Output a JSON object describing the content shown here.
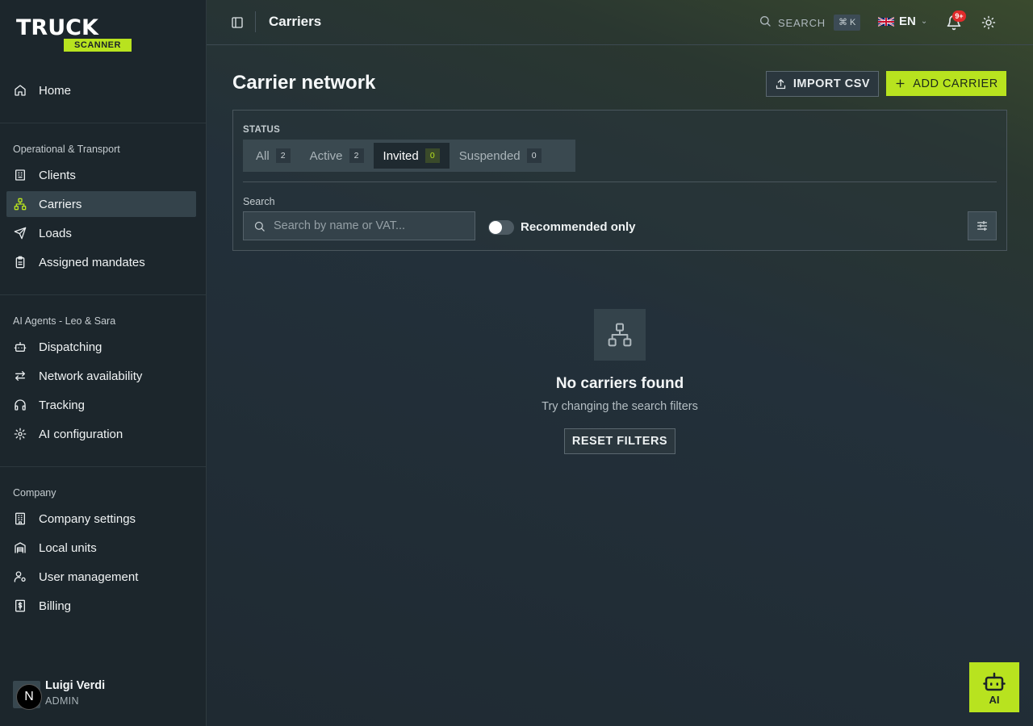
{
  "brand": {
    "name_top": "TRUCK",
    "name_bottom": "SCANNER",
    "accent_color": "#b8e31f"
  },
  "sidebar": {
    "home": {
      "label": "Home",
      "icon": "home-icon"
    },
    "sections": [
      {
        "title": "Operational & Transport"
      },
      {
        "title": "AI Agents - Leo & Sara"
      },
      {
        "title": "Company"
      }
    ],
    "items": {
      "clients": {
        "label": "Clients",
        "icon": "building-icon"
      },
      "carriers": {
        "label": "Carriers",
        "icon": "network-icon",
        "active": true
      },
      "loads": {
        "label": "Loads",
        "icon": "send-icon"
      },
      "mandates": {
        "label": "Assigned mandates",
        "icon": "clipboard-icon"
      },
      "dispatching": {
        "label": "Dispatching",
        "icon": "bot-icon"
      },
      "network": {
        "label": "Network availability",
        "icon": "arrows-icon"
      },
      "tracking": {
        "label": "Tracking",
        "icon": "headphones-icon"
      },
      "ai_config": {
        "label": "AI configuration",
        "icon": "gear-icon"
      },
      "company_settings": {
        "label": "Company settings",
        "icon": "office-icon"
      },
      "local_units": {
        "label": "Local units",
        "icon": "warehouse-icon"
      },
      "user_management": {
        "label": "User management",
        "icon": "user-cog-icon"
      },
      "billing": {
        "label": "Billing",
        "icon": "dollar-icon"
      }
    },
    "user": {
      "initial": "N",
      "name": "Luigi Verdi",
      "role": "ADMIN"
    }
  },
  "topbar": {
    "title": "Carriers",
    "search_label": "SEARCH",
    "shortcut": "⌘ K",
    "language": "EN",
    "notifications_badge": "9+"
  },
  "page": {
    "title": "Carrier network",
    "import_label": "IMPORT CSV",
    "add_label": "ADD CARRIER"
  },
  "filters": {
    "status_label": "STATUS",
    "tabs": [
      {
        "label": "All",
        "count": "2"
      },
      {
        "label": "Active",
        "count": "2"
      },
      {
        "label": "Invited",
        "count": "0",
        "active": true
      },
      {
        "label": "Suspended",
        "count": "0"
      }
    ],
    "search_label": "Search",
    "search_placeholder": "Search by name or VAT...",
    "recommended_label": "Recommended only",
    "recommended_on": false
  },
  "empty_state": {
    "title": "No carriers found",
    "subtitle": "Try changing the search filters",
    "reset_label": "RESET FILTERS"
  },
  "ai_button": {
    "label": "AI"
  }
}
